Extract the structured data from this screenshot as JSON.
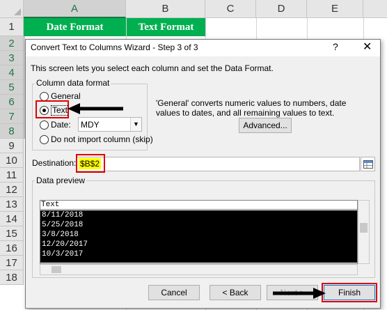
{
  "sheet": {
    "columns": [
      "A",
      "B",
      "C",
      "D",
      "E"
    ],
    "rows": [
      "1",
      "2",
      "3",
      "4",
      "5",
      "6",
      "7",
      "8",
      "9",
      "10",
      "11",
      "12",
      "13",
      "14",
      "15",
      "16",
      "17",
      "18"
    ],
    "header_a": "Date Format",
    "header_b": "Text Format"
  },
  "dialog": {
    "title": "Convert Text to Columns Wizard - Step 3 of 3",
    "help_glyph": "?",
    "close_glyph": "✕",
    "intro": "This screen lets you select each column and set the Data Format.",
    "group_label": "Column data format",
    "options": [
      "General",
      "Text",
      "Date:",
      "Do not import column (skip)"
    ],
    "selected_option": "Text",
    "date_format": "MDY",
    "description": "'General' converts numeric values to numbers, date values to dates, and all remaining values to text.",
    "advanced_button": "Advanced...",
    "destination_label": "Destination:",
    "destination_value": "$B$2",
    "preview_label": "Data preview",
    "preview_header": "Text",
    "preview_rows": [
      "8/11/2018",
      "5/25/2018",
      "3/8/2018",
      "12/20/2017",
      "10/3/2017"
    ],
    "buttons": {
      "cancel": "Cancel",
      "back": "< Back",
      "next": "Next >",
      "finish": "Finish"
    }
  }
}
